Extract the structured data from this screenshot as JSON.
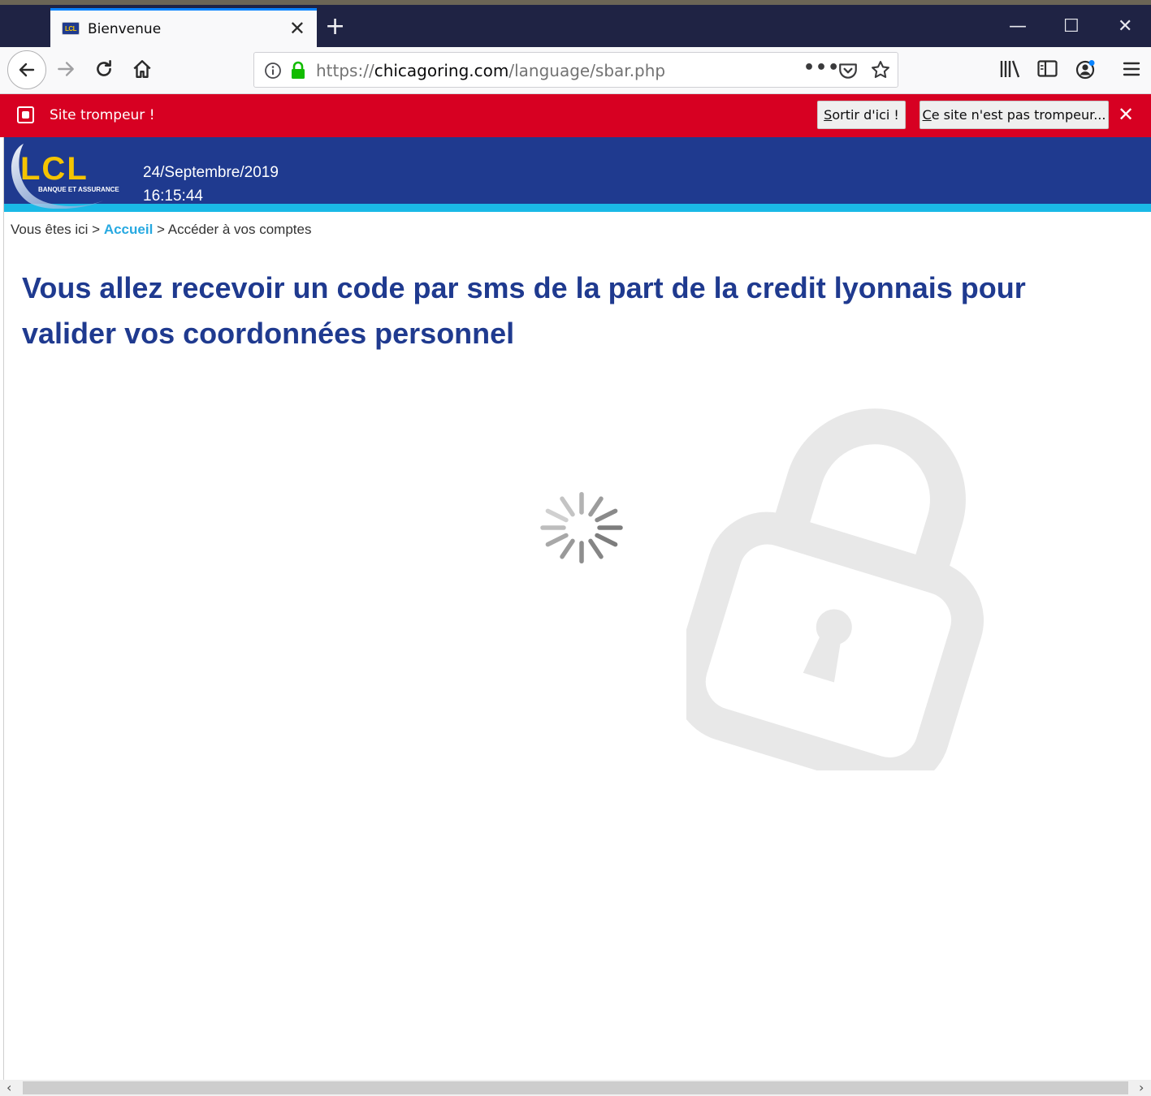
{
  "browser": {
    "tab": {
      "title": "Bienvenue",
      "favicon": "LCL"
    },
    "new_tab_symbol": "+",
    "url": {
      "scheme": "https://",
      "domain": "chicagoring.com",
      "path": "/language/sbar.php"
    }
  },
  "warning_bar": {
    "message": "Site trompeur !",
    "exit_button": {
      "accesskey": "S",
      "rest": "ortir d'ici !"
    },
    "not_deceptive_button": {
      "accesskey": "C",
      "rest": "e site n'est pas trompeur..."
    }
  },
  "site": {
    "logo": {
      "letters": "LCL",
      "tagline": "BANQUE ET ASSURANCE"
    },
    "header": {
      "date": "24/Septembre/2019",
      "time": "16:15:44"
    },
    "breadcrumb": {
      "prefix": "Vous êtes ici >",
      "home": "Accueil",
      "current": "> Accéder à vos comptes"
    },
    "headline": "Vous allez recevoir un code par sms de la part de la credit lyonnais pour valider vos coordonnées personnel"
  },
  "colors": {
    "warning_red": "#d70022",
    "brand_blue": "#1f3a8f",
    "accent_cyan": "#1ab9e6",
    "logo_yellow": "#f5c400"
  }
}
